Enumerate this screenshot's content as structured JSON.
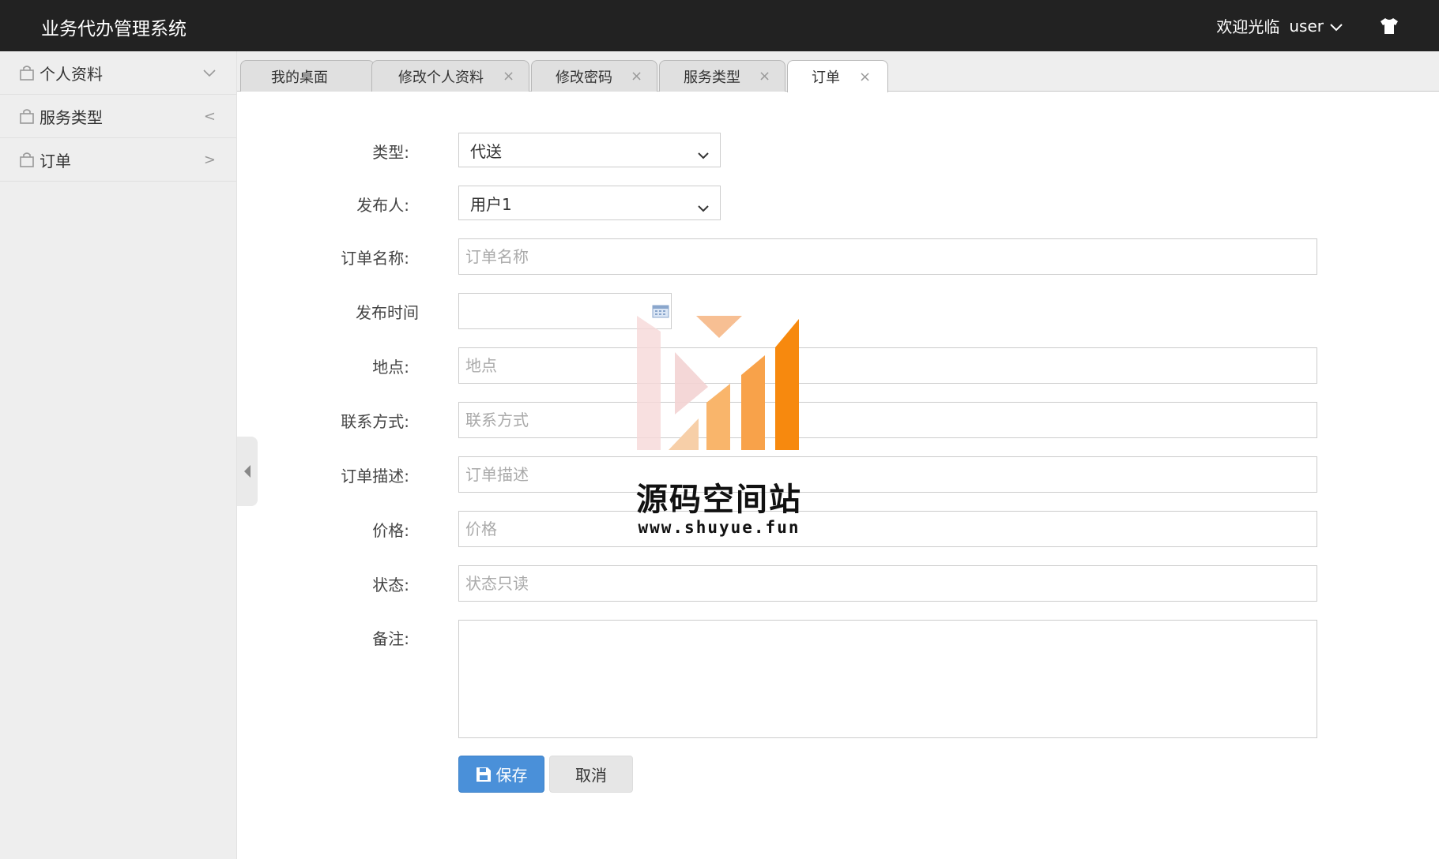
{
  "header": {
    "app_title": "业务代办管理系统",
    "welcome": "欢迎光临",
    "username": "user",
    "skin_icon": "tshirt-icon"
  },
  "sidebar": {
    "items": [
      {
        "label": "个人资料",
        "icon": "bag-icon",
        "arrow": "chevron-down"
      },
      {
        "label": "服务类型",
        "icon": "bag-icon",
        "arrow": "<"
      },
      {
        "label": "订单",
        "icon": "bag-icon",
        "arrow": ">"
      }
    ]
  },
  "tabs": [
    {
      "label": "我的桌面",
      "closable": false,
      "active": false
    },
    {
      "label": "修改个人资料",
      "closable": true,
      "active": false
    },
    {
      "label": "修改密码",
      "closable": true,
      "active": false
    },
    {
      "label": "服务类型",
      "closable": true,
      "active": false
    },
    {
      "label": "订单",
      "closable": true,
      "active": true
    }
  ],
  "tab_close_glyph": "×",
  "form": {
    "type": {
      "label": "类型:",
      "value": "代送"
    },
    "publisher": {
      "label": "发布人:",
      "value": "用户1"
    },
    "order_name": {
      "label": "订单名称:",
      "placeholder": "订单名称"
    },
    "publish_time": {
      "label": "发布时间",
      "value": ""
    },
    "location": {
      "label": "地点:",
      "placeholder": "地点"
    },
    "contact": {
      "label": "联系方式:",
      "placeholder": "联系方式"
    },
    "description": {
      "label": "订单描述:",
      "placeholder": "订单描述"
    },
    "price": {
      "label": "价格:",
      "placeholder": "价格"
    },
    "status": {
      "label": "状态:",
      "placeholder": "状态只读"
    },
    "remark": {
      "label": "备注:",
      "value": ""
    },
    "save_label": "保存",
    "cancel_label": "取消"
  },
  "watermark": {
    "name": "源码空间站",
    "url": "www.shuyue.fun"
  },
  "colors": {
    "topbar": "#222222",
    "sidebar": "#eeeeee",
    "primary_button": "#4a90d9",
    "watermark_orange": "#f7941d"
  }
}
